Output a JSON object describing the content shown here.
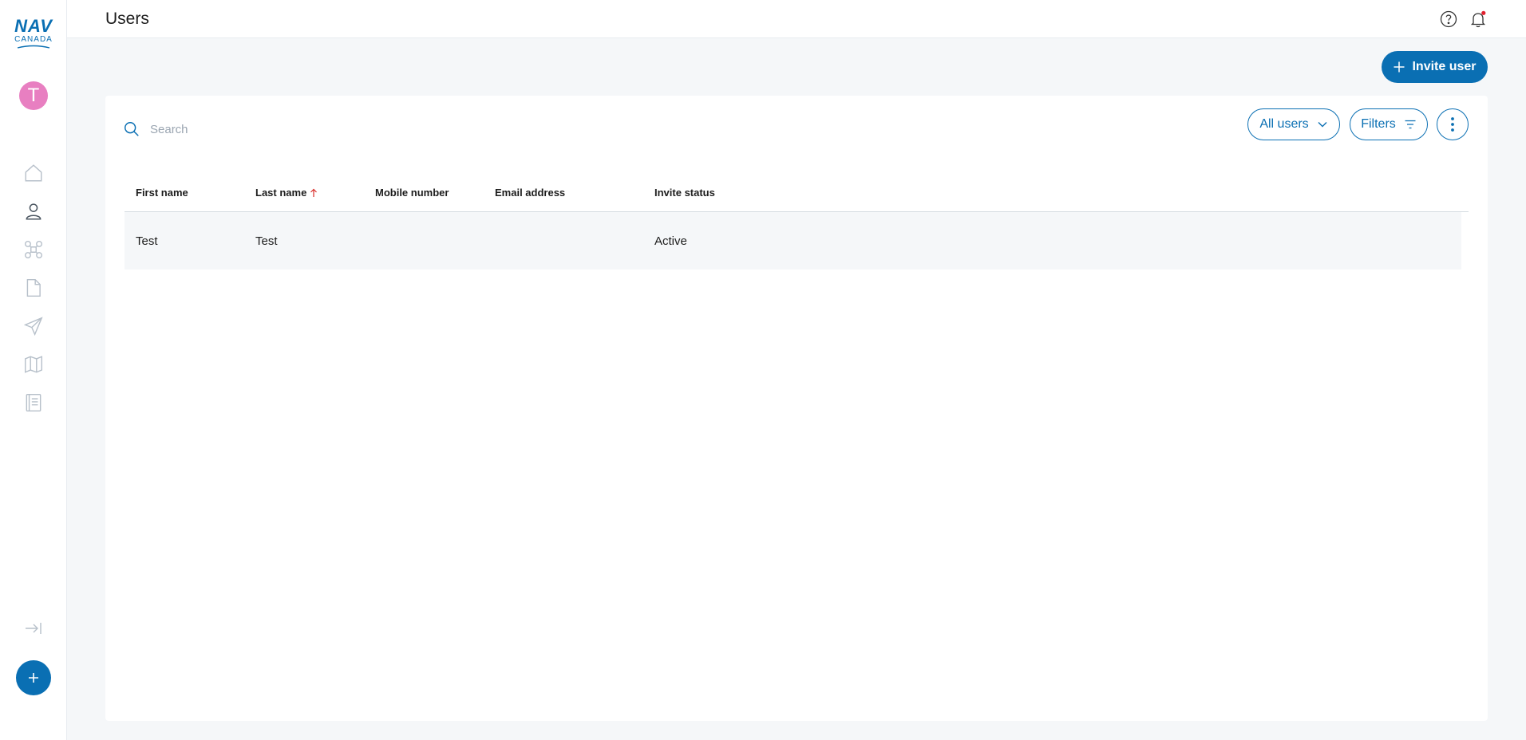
{
  "brand": {
    "logo_main": "NAV",
    "logo_sub": "CANADA",
    "accent_color": "#0a6fb3"
  },
  "user": {
    "avatar_initial": "T",
    "avatar_color": "#e87fc1"
  },
  "sidebar": {
    "items": [
      {
        "icon": "home-icon"
      },
      {
        "icon": "user-icon"
      },
      {
        "icon": "drone-icon"
      },
      {
        "icon": "document-icon"
      },
      {
        "icon": "send-icon"
      },
      {
        "icon": "map-icon"
      },
      {
        "icon": "logbook-icon"
      }
    ],
    "collapse_icon": "collapse-icon",
    "fab_icon": "plus-icon"
  },
  "header": {
    "title": "Users",
    "help_icon": "help-icon",
    "notification_icon": "bell-icon"
  },
  "toolbar": {
    "invite_label": "Invite user",
    "search_placeholder": "Search",
    "scope_label": "All users",
    "filters_label": "Filters"
  },
  "table": {
    "columns": [
      "First name",
      "Last name",
      "Mobile number",
      "Email address",
      "Invite status"
    ],
    "sort_column": "Last name",
    "sort_direction": "ascending",
    "rows": [
      {
        "first_name": "Test",
        "last_name": "Test",
        "mobile": "",
        "email": "",
        "status": "Active"
      }
    ]
  }
}
